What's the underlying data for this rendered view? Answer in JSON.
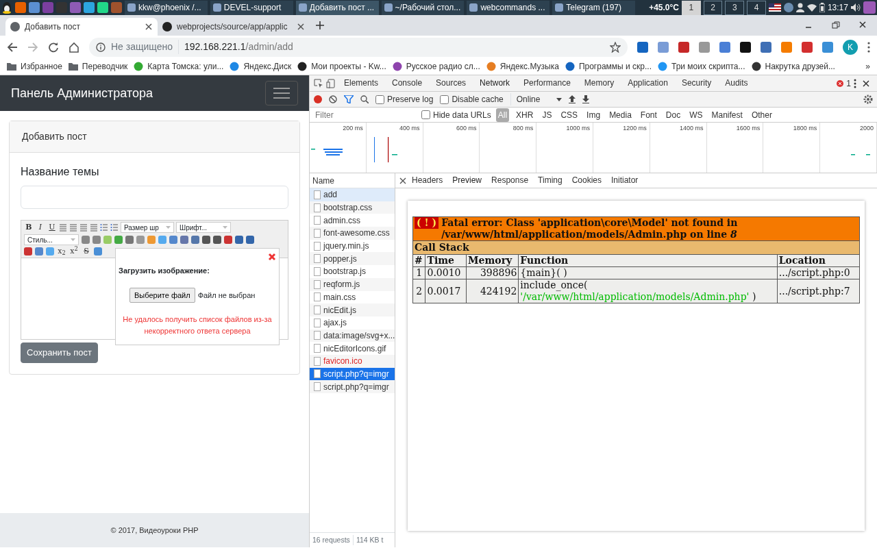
{
  "taskbar": {
    "windows": [
      {
        "title": "kkw@phoenix /...",
        "selected": false
      },
      {
        "title": "DEVEL-support",
        "selected": false
      },
      {
        "title": "Добавить пост ...",
        "selected": true
      },
      {
        "title": "~/Рабочий стол...",
        "selected": false
      },
      {
        "title": "webcommands ...",
        "selected": false
      },
      {
        "title": "Telegram (197)",
        "selected": false
      }
    ],
    "temperature": "+45.0°C",
    "workspaces": [
      {
        "label": "1",
        "selected": true
      },
      {
        "label": "2",
        "selected": false
      },
      {
        "label": "3",
        "selected": false
      },
      {
        "label": "4",
        "selected": false
      }
    ],
    "clock": "13:17"
  },
  "browser": {
    "tabs": [
      {
        "title": "Добавить пост",
        "selected": true
      },
      {
        "title": "webprojects/source/app/applic",
        "selected": false
      }
    ],
    "security": "Не защищено",
    "url_host": "192.168.221.1",
    "url_path": "/admin/add",
    "profile_initial": "K",
    "bookmarks": [
      {
        "label": "Избранное",
        "kind": "folder"
      },
      {
        "label": "Переводчик",
        "kind": "folder"
      },
      {
        "label": "Карта Томска: ули...",
        "kind": "site"
      },
      {
        "label": "Яндекс.Диск",
        "kind": "site"
      },
      {
        "label": "Мои проекты - Kw...",
        "kind": "site"
      },
      {
        "label": "Русское радио сл...",
        "kind": "site"
      },
      {
        "label": "Яндекс.Музыка",
        "kind": "site"
      },
      {
        "label": "Программы и скр...",
        "kind": "site"
      },
      {
        "label": "Три моих скрипта...",
        "kind": "site"
      },
      {
        "label": "Накрутка  друзей...",
        "kind": "site"
      }
    ],
    "more_bookmarks": "»"
  },
  "page": {
    "brand": "Панель Администратора",
    "card_title": "Добавить пост",
    "topic_label": "Название темы",
    "editor": {
      "format_buttons": [
        "B",
        "I",
        "U"
      ],
      "size_select": "Размер шр",
      "font_select": "Шрифт...",
      "style_select": "Стиль...",
      "script_buttons": [
        "x$_{2}$",
        "x$^{2}$",
        "S"
      ]
    },
    "upload_popup": {
      "title": "Загрузить изображение:",
      "file_button": "Выберите файл",
      "file_status": "Файл не выбран",
      "error": "Не удалось получить список файлов из-за некорректного ответа сервера"
    },
    "save_button": "Сохранить пост",
    "footer": "© 2017, Видеоуроки PHP"
  },
  "devtools": {
    "tabs": [
      {
        "label": "Elements",
        "selected": false
      },
      {
        "label": "Console",
        "selected": false
      },
      {
        "label": "Sources",
        "selected": false
      },
      {
        "label": "Network",
        "selected": true
      },
      {
        "label": "Performance",
        "selected": false
      },
      {
        "label": "Memory",
        "selected": false
      },
      {
        "label": "Application",
        "selected": false
      },
      {
        "label": "Security",
        "selected": false
      },
      {
        "label": "Audits",
        "selected": false
      }
    ],
    "error_count": "1",
    "preserve_log": {
      "label": "Preserve log",
      "checked": false
    },
    "disable_cache": {
      "label": "Disable cache",
      "checked": false
    },
    "throttling": "Online",
    "filter": {
      "placeholder": "Filter"
    },
    "hide_data_urls": {
      "label": "Hide data URLs",
      "checked": false
    },
    "type_filters": [
      {
        "label": "All",
        "selected": true
      },
      {
        "label": "XHR",
        "selected": false
      },
      {
        "label": "JS",
        "selected": false
      },
      {
        "label": "CSS",
        "selected": false
      },
      {
        "label": "Img",
        "selected": false
      },
      {
        "label": "Media",
        "selected": false
      },
      {
        "label": "Font",
        "selected": false
      },
      {
        "label": "Doc",
        "selected": false
      },
      {
        "label": "WS",
        "selected": false
      },
      {
        "label": "Manifest",
        "selected": false
      },
      {
        "label": "Other",
        "selected": false
      }
    ],
    "timeline_ticks": [
      "200 ms",
      "400 ms",
      "600 ms",
      "800 ms",
      "1000 ms",
      "1200 ms",
      "1400 ms",
      "1600 ms",
      "1800 ms",
      "2000"
    ],
    "name_header": "Name",
    "requests": [
      {
        "name": "add",
        "selected": false,
        "highlighted": true,
        "failed": false
      },
      {
        "name": "bootstrap.css",
        "selected": false,
        "highlighted": false,
        "failed": false
      },
      {
        "name": "admin.css",
        "selected": false,
        "highlighted": false,
        "failed": false
      },
      {
        "name": "font-awesome.css",
        "selected": false,
        "highlighted": false,
        "failed": false
      },
      {
        "name": "jquery.min.js",
        "selected": false,
        "highlighted": false,
        "failed": false
      },
      {
        "name": "popper.js",
        "selected": false,
        "highlighted": false,
        "failed": false
      },
      {
        "name": "bootstrap.js",
        "selected": false,
        "highlighted": false,
        "failed": false
      },
      {
        "name": "reqform.js",
        "selected": false,
        "highlighted": false,
        "failed": false
      },
      {
        "name": "main.css",
        "selected": false,
        "highlighted": false,
        "failed": false
      },
      {
        "name": "nicEdit.js",
        "selected": false,
        "highlighted": false,
        "failed": false
      },
      {
        "name": "ajax.js",
        "selected": false,
        "highlighted": false,
        "failed": false
      },
      {
        "name": "data:image/svg+x...",
        "selected": false,
        "highlighted": false,
        "failed": false
      },
      {
        "name": "nicEditorIcons.gif",
        "selected": false,
        "highlighted": false,
        "failed": false
      },
      {
        "name": "favicon.ico",
        "selected": false,
        "highlighted": false,
        "failed": true
      },
      {
        "name": "script.php?q=imgr",
        "selected": true,
        "highlighted": false,
        "failed": false
      },
      {
        "name": "script.php?q=imgr",
        "selected": false,
        "highlighted": false,
        "failed": false
      }
    ],
    "summary": [
      "16 requests",
      "114 KB t"
    ],
    "detail_tabs": [
      {
        "label": "Headers",
        "selected": false
      },
      {
        "label": "Preview",
        "selected": true
      },
      {
        "label": "Response",
        "selected": false
      },
      {
        "label": "Timing",
        "selected": false
      },
      {
        "label": "Cookies",
        "selected": false
      },
      {
        "label": "Initiator",
        "selected": false
      }
    ],
    "preview": {
      "error_icon": "( ! )",
      "message": "Fatal error: Class 'application\\core\\Model' not found in /var/www/html/application/models/Admin.php on line *8*",
      "stack_title": "Call Stack",
      "columns": [
        "#",
        "Time",
        "Memory",
        "Function",
        "Location"
      ],
      "rows": [
        {
          "num": "1",
          "time": "0.0010",
          "memory": "398896",
          "function": "{main}( )",
          "location": ".../script.php:0"
        },
        {
          "num": "2",
          "time": "0.0017",
          "memory": "424192",
          "function": "include_once(",
          "argument": "'/var/www/html/application/models/Admin.php'",
          "function_end": " )",
          "location": ".../script.php:7"
        }
      ]
    }
  }
}
